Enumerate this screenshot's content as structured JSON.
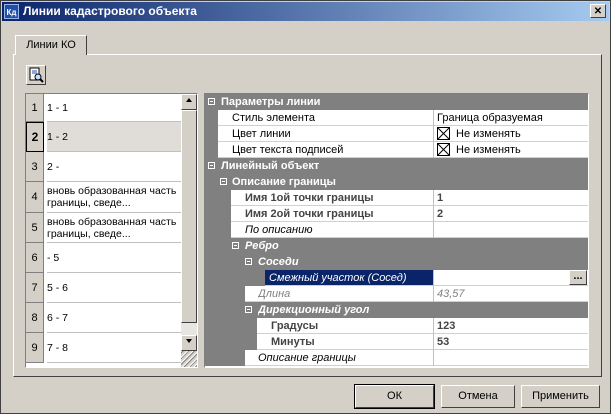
{
  "window": {
    "title": "Линии кадастрового объекта",
    "icon_text": "Кд",
    "close_glyph": "✕"
  },
  "tabs": [
    {
      "label": "Линии КО"
    }
  ],
  "toolbar": {
    "preview_icon": "page-search-icon"
  },
  "lines": [
    {
      "num": "1",
      "text": "1 - 1",
      "selected": false
    },
    {
      "num": "2",
      "text": "1 - 2",
      "selected": true
    },
    {
      "num": "3",
      "text": "2 -",
      "selected": false
    },
    {
      "num": "4",
      "text": "вновь образованная часть границы, сведе...",
      "selected": false
    },
    {
      "num": "5",
      "text": "вновь образованная часть границы, сведе...",
      "selected": false
    },
    {
      "num": "6",
      "text": " - 5",
      "selected": false
    },
    {
      "num": "7",
      "text": "5 - 6",
      "selected": false
    },
    {
      "num": "8",
      "text": "6 - 7",
      "selected": false
    },
    {
      "num": "9",
      "text": "7 - 8",
      "selected": false
    }
  ],
  "properties": {
    "line_params": {
      "label": "Параметры линии"
    },
    "element_style": {
      "label": "Стиль элемента",
      "value": "Граница образуемая"
    },
    "line_color": {
      "label": "Цвет линии",
      "value": "Не изменять"
    },
    "caption_color": {
      "label": "Цвет текста подписей",
      "value": "Не изменять"
    },
    "linear_object": {
      "label": "Линейный объект"
    },
    "boundary_desc": {
      "label": "Описание границы"
    },
    "point1_name": {
      "label": "Имя 1ой точки границы",
      "value": "1"
    },
    "point2_name": {
      "label": "Имя 2ой точки границы",
      "value": "2"
    },
    "by_description": {
      "label": "По описанию",
      "value": ""
    },
    "edge": {
      "label": "Ребро"
    },
    "neighbors": {
      "label": "Соседи"
    },
    "adjacent_plot": {
      "label": "Смежный участок (Сосед)",
      "value": "",
      "button": "..."
    },
    "length": {
      "label": "Длина",
      "value": "43,57"
    },
    "bearing": {
      "label": "Дирекционный угол"
    },
    "degrees": {
      "label": "Градусы",
      "value": "123"
    },
    "minutes": {
      "label": "Минуты",
      "value": "53"
    },
    "boundary_description": {
      "label": "Описание  границы",
      "value": ""
    }
  },
  "buttons": {
    "ok": "ОК",
    "cancel": "Отмена",
    "apply": "Применить"
  }
}
